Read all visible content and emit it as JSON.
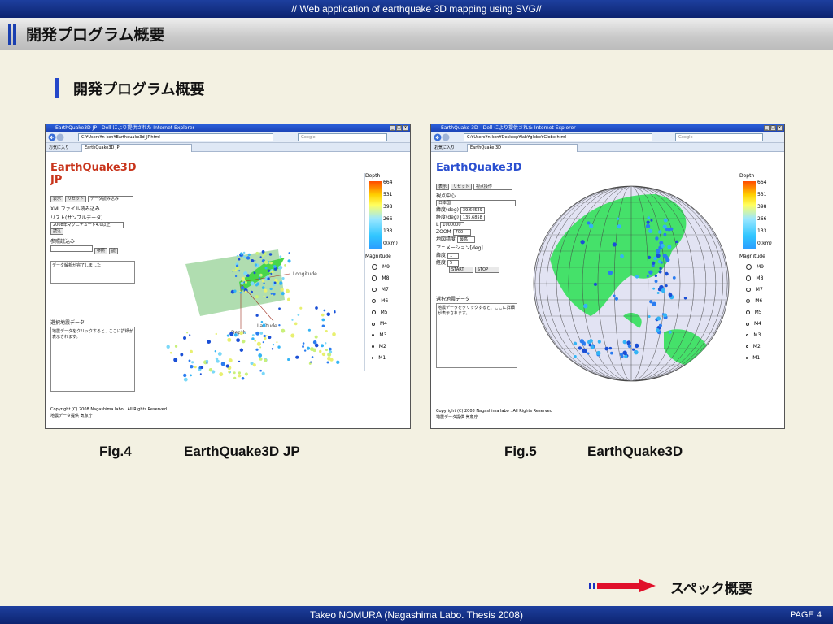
{
  "header": {
    "banner": "// Web application of earthquake 3D mapping using SVG//",
    "title": "開発プログラム概要"
  },
  "section": {
    "title": "開発プログラム概要"
  },
  "fig4": {
    "window_title": "EarthQuake3D JP - Dell により提供された Internet Explorer",
    "url": "C:¥Users¥n-ken¥Earthquake3d_JP.html",
    "search": "Google",
    "favorites": "お気に入り",
    "tab": "EarthQuake3D JP",
    "logo": "EarthQuake3D JP",
    "btn_show": "表示",
    "btn_reset": "リセット",
    "mode_select": "データ読み込み",
    "xml_label": "XMLファイル読み込み",
    "list_label": "リスト(サンプルデータ)",
    "list_select": "2008年マグニチュード4.0以上",
    "btn_load": "読込",
    "ref_label": "参照読込み",
    "btn_browse": "参照",
    "btn_read": "読",
    "status_text": "データ解析が完了しました",
    "selected_label": "選択地震データ",
    "selected_text": "地震データをクリックすると、ここに詳細が表示されます。",
    "copyright": "Copyright (C) 2008 Nagashima labo . All Rights Reserved",
    "provider": "地震データ提供 気象庁",
    "axis_longitude": "Longitude",
    "axis_latitude": "Latitude",
    "axis_depth": "Depth"
  },
  "fig5": {
    "window_title": "EarthQuake 3D - Dell により提供された Internet Explorer",
    "url": "C:¥Users¥n-ken¥Desktop¥lab¥globe¥Globe.html",
    "search": "Google",
    "favorites": "お気に入り",
    "tab": "EarthQuake 3D",
    "logo": "EarthQuake3D",
    "btn_show": "表示",
    "btn_reset": "リセット",
    "mode_select": "視点操作",
    "viewpoint_label": "視点中心",
    "viewpoint_select": "日本国",
    "lat_label": "緯度(deg)",
    "lat_value": "39.64529",
    "lon_label": "経度(deg)",
    "lon_value": "135.6858",
    "l_label": "L",
    "l_value": "1000000",
    "zoom_label": "ZOOM",
    "zoom_value": "700",
    "map_label": "地図精度",
    "map_value": "最高",
    "anim_label": "アニメーション[deg]",
    "anim_lat_label": "緯度",
    "anim_lat_value": "1",
    "anim_lon_label": "経度",
    "anim_lon_value": "5",
    "btn_start": "START",
    "btn_stop": "STOP",
    "selected_label": "選択地震データ",
    "selected_text": "地震データをクリックすると、ここに詳細が表示されます。",
    "copyright": "Copyright (C) 2008 Nagashima labo . All Rights Reserved",
    "provider": "地震データ提供 気象庁"
  },
  "legend": {
    "depth_label": "Depth",
    "depth_ticks": [
      "664",
      "531",
      "398",
      "266",
      "133",
      "0(km)"
    ],
    "magnitude_label": "Magnitude",
    "magnitudes": [
      "M9",
      "M8",
      "M7",
      "M6",
      "M5",
      "M4",
      "M3",
      "M2",
      "M1"
    ]
  },
  "captions": {
    "fig4_num": "Fig.4",
    "fig4_name": "EarthQuake3D JP",
    "fig5_num": "Fig.5",
    "fig5_name": "EarthQuake3D"
  },
  "nav": {
    "spec_link": "スペック概要"
  },
  "footer": {
    "credit": "Takeo NOMURA (Nagashima Labo. Thesis 2008)",
    "page": "PAGE 4"
  },
  "colors": {
    "banner": "#1d3f9e",
    "accent": "#2447c9",
    "background": "#f3f1e2",
    "land": "#3ce06a",
    "quake_deep": "#1a4fd6"
  }
}
